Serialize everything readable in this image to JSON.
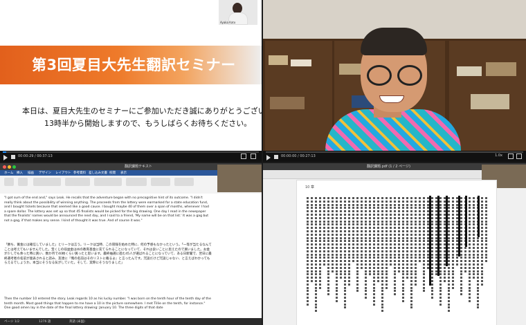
{
  "slide": {
    "title": "第3回夏目大先生翻訳セミナー",
    "line1": "本日は、夏目大先生のセミナーにご参加いただき誠にありがとうございます。",
    "line2": "13時半から開始しますので、もうしばらくお待ちください。",
    "attendee_label": "Ayaka Kato",
    "brand_color": "#e96b22"
  },
  "player_top_left": {
    "time": "00:00:29 / 00:37:13",
    "progress": 0.013
  },
  "player_top_right": {
    "time": "00:00:00 / 00:27:13",
    "progress": 0.0,
    "speed": "1.0x"
  },
  "word": {
    "window_title": "翻訳課題テキスト",
    "tabs": [
      "ホーム",
      "挿入",
      "描画",
      "デザイン",
      "レイアウト",
      "参考資料",
      "差し込み文書",
      "校閲",
      "表示"
    ],
    "para1": "\"I got sum of the end and,\" says Leak. He recalls that the adventure began with no precognitive hint of its outcome. \"I didn't really think about the possibility of winning anything. The proceeds from the lottery were earmarked for a state education fund, and I bought tickets because that seemed like a good cause. I bought maybe 40 of them over a span of months, whenever I had a spare dollar. The lottery was set up so that 45 finalists would be picked for the big drawing. One day I read in the newspaper that the finalists' names would be announced the next day, and I said to a friend, 'My name will be on that list.' It was a gag but not a gag, if that makes any sense. I kind of thought it was true. And of course it was.\"",
    "para2": "「勝ち、賞金には確信していました」とリークは言う。リークは当時、この冒険を始めた時に、何の予感もなかったという。「一等が当たるなんてことは考えてもいませんでした。宝くじの収益金は州の教育基金に充てられることになっていて、それは良いことに思えたので買いました。お金が少しでも余った時に買い、数か月で40枚くらい買ったと思います。最終抽選に進む45人が選ばれることになっていて、ある日新聞で、翌日に最終選考者の名前が発表されると読み、友達に『俺の名前はそのリストに載るよ』と言ったんです。冗談だけど冗談じゃない、と言えばわかってもらえるでしょうか。本当にそうなる気がしていた。そして、実際にそうなりました」",
    "para3": "Then the number 10 entered the story. Leak regards 10 as his lucky number. \"I was born on the tenth hour of the tenth day of the tenth month. Most good things that happen to me have a 10 in the picture somewhere. I met Tillie on the tenth, for instance.\" One good omen lay in the date of the final lottery drawing: January 10. The three digits of that date",
    "status_page": "ページ 1/2",
    "status_words": "1276 語",
    "status_lang": "英語 (米国)"
  },
  "pdf": {
    "window_title": "翻訳課題.pdf (1 / 2 ページ)",
    "page_header": "10 章"
  }
}
